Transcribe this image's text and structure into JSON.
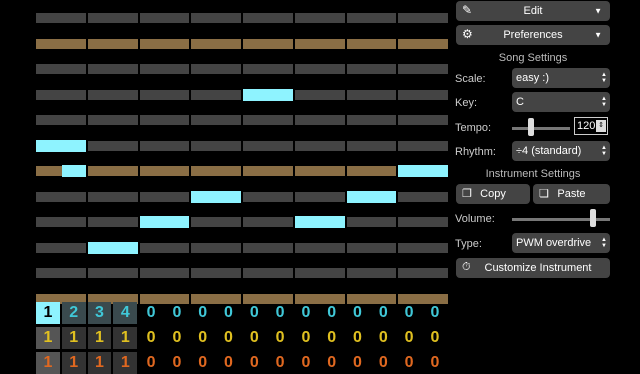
{
  "colors": {
    "row_dark": "#444444",
    "row_brown": "#8a6e45",
    "note": "#8ef3ff",
    "bar": "#8ef3ff"
  },
  "pattern_rows": [
    {
      "type": "dark",
      "notes": []
    },
    {
      "type": "brown",
      "notes": []
    },
    {
      "type": "dark",
      "notes": []
    },
    {
      "type": "dark",
      "notes": [
        4
      ]
    },
    {
      "type": "dark",
      "notes": []
    },
    {
      "type": "dark",
      "notes": [
        0
      ]
    },
    {
      "type": "brown",
      "notes": [
        0.5,
        7
      ]
    },
    {
      "type": "dark",
      "notes": [
        3,
        6
      ]
    },
    {
      "type": "dark",
      "notes": [
        2,
        5
      ]
    },
    {
      "type": "dark",
      "notes": [
        1
      ]
    },
    {
      "type": "dark",
      "notes": []
    },
    {
      "type": "brown",
      "notes": []
    }
  ],
  "channel_rows": [
    {
      "values": [
        "1",
        "2",
        "3",
        "4",
        "0",
        "0",
        "0",
        "0",
        "0",
        "0",
        "0",
        "0",
        "0",
        "0",
        "0",
        "0"
      ],
      "color": "#40c8d8",
      "selected": 0
    },
    {
      "values": [
        "1",
        "1",
        "1",
        "1",
        "0",
        "0",
        "0",
        "0",
        "0",
        "0",
        "0",
        "0",
        "0",
        "0",
        "0",
        "0"
      ],
      "color": "#e0c020",
      "selected": 0
    },
    {
      "values": [
        "1",
        "1",
        "1",
        "1",
        "0",
        "0",
        "0",
        "0",
        "0",
        "0",
        "0",
        "0",
        "0",
        "0",
        "0",
        "0"
      ],
      "color": "#e06820",
      "selected": 0
    }
  ],
  "menu": {
    "edit_label": "Edit",
    "preferences_label": "Preferences"
  },
  "song_settings": {
    "heading": "Song Settings",
    "scale_label": "Scale:",
    "scale_value": "easy :)",
    "key_label": "Key:",
    "key_value": "C",
    "tempo_label": "Tempo:",
    "tempo_value": "120",
    "tempo_level": 0.3,
    "rhythm_label": "Rhythm:",
    "rhythm_value": "÷4 (standard)"
  },
  "instrument_settings": {
    "heading": "Instrument Settings",
    "copy_label": "Copy",
    "paste_label": "Paste",
    "volume_label": "Volume:",
    "volume_level": 0.85,
    "type_label": "Type:",
    "type_value": "PWM overdrive",
    "customize_label": "Customize Instrument"
  }
}
